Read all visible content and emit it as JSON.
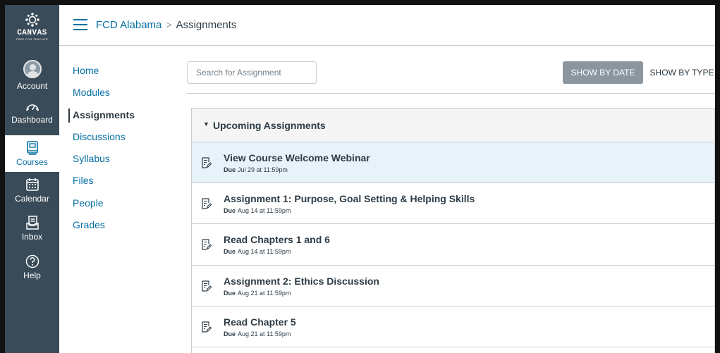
{
  "global_nav": {
    "logo_word": "CANVAS",
    "logo_sub": "FREE FOR TEACHER",
    "items": [
      {
        "label": "Account",
        "icon": "avatar"
      },
      {
        "label": "Dashboard",
        "icon": "speedometer-icon"
      },
      {
        "label": "Courses",
        "icon": "book-icon",
        "active": true
      },
      {
        "label": "Calendar",
        "icon": "calendar-icon"
      },
      {
        "label": "Inbox",
        "icon": "inbox-icon"
      },
      {
        "label": "Help",
        "icon": "question-circle-icon"
      }
    ]
  },
  "header": {
    "course": "FCD Alabama",
    "separator": ">",
    "page": "Assignments"
  },
  "course_nav": {
    "items": [
      {
        "label": "Home"
      },
      {
        "label": "Modules"
      },
      {
        "label": "Assignments",
        "active": true
      },
      {
        "label": "Discussions"
      },
      {
        "label": "Syllabus"
      },
      {
        "label": "Files"
      },
      {
        "label": "People"
      },
      {
        "label": "Grades"
      }
    ]
  },
  "toolbar": {
    "search_placeholder": "Search for Assignment",
    "show_by_date": "SHOW BY DATE",
    "show_by_type": "SHOW BY TYPE"
  },
  "group": {
    "caret": "▼",
    "title": "Upcoming Assignments",
    "assignments": [
      {
        "name": "View Course Welcome Webinar",
        "due_label": "Due",
        "due_date": "Jul 29 at 11:59pm"
      },
      {
        "name": "Assignment 1: Purpose, Goal Setting & Helping Skills",
        "due_label": "Due",
        "due_date": "Aug 14 at 11:59pm"
      },
      {
        "name": "Read Chapters 1 and 6",
        "due_label": "Due",
        "due_date": "Aug 14 at 11:59pm"
      },
      {
        "name": "Assignment 2: Ethics Discussion",
        "due_label": "Due",
        "due_date": "Aug 21 at 11:59pm"
      },
      {
        "name": "Read Chapter 5",
        "due_label": "Due",
        "due_date": "Aug 21 at 11:59pm"
      }
    ]
  },
  "colors": {
    "nav_bg": "#394b58",
    "link": "#0770a3",
    "text": "#2d3b45",
    "highlight_row": "#e8f2f9",
    "active_button": "#8b969e"
  }
}
